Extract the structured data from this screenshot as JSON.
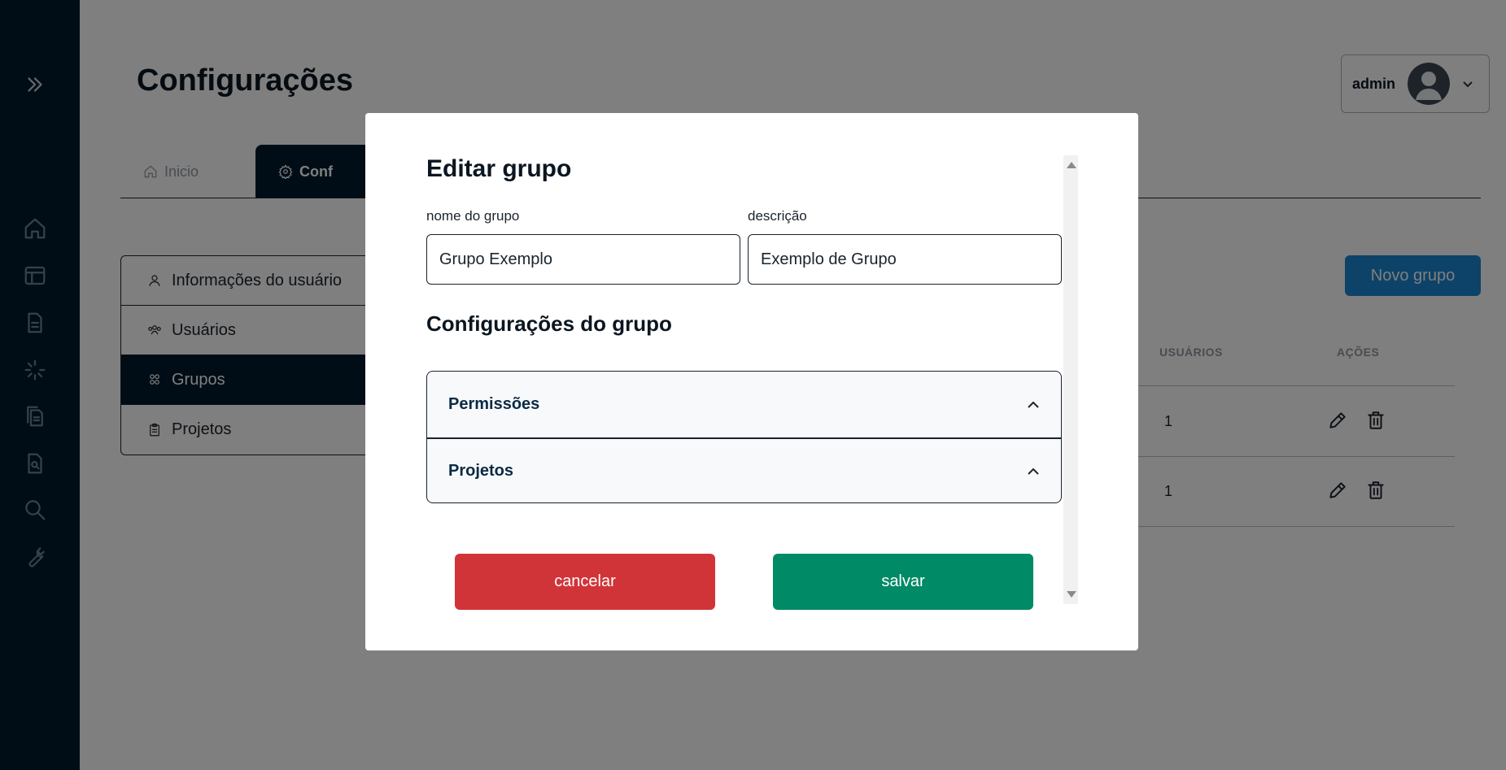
{
  "page": {
    "title": "Configurações"
  },
  "user_menu": {
    "name": "admin"
  },
  "tabs": [
    {
      "label": "Inicio",
      "icon": "home-icon"
    },
    {
      "label": "Conf",
      "icon": "gear-icon"
    }
  ],
  "side_menu": {
    "items": [
      {
        "label": "Informações do usuário",
        "icon": "user-icon"
      },
      {
        "label": "Usuários",
        "icon": "users-icon"
      },
      {
        "label": "Grupos",
        "icon": "group-icon"
      },
      {
        "label": "Projetos",
        "icon": "clipboard-icon"
      }
    ]
  },
  "groups_panel": {
    "new_button": "Novo grupo",
    "columns": {
      "users": "USUÁRIOS",
      "actions": "AÇÕES"
    },
    "rows": [
      {
        "users": "1"
      },
      {
        "users": "1"
      }
    ]
  },
  "modal": {
    "title": "Editar grupo",
    "name_label": "nome do grupo",
    "name_value": "Grupo Exemplo",
    "desc_label": "descrição",
    "desc_value": "Exemplo de Grupo",
    "section_title": "Configurações do grupo",
    "accordion": [
      {
        "label": "Permissões"
      },
      {
        "label": "Projetos"
      }
    ],
    "cancel_label": "cancelar",
    "save_label": "salvar"
  },
  "colors": {
    "sidebar": "#001a2c",
    "primary": "#1a86d0",
    "cancel": "#d13438",
    "save": "#008a66"
  }
}
